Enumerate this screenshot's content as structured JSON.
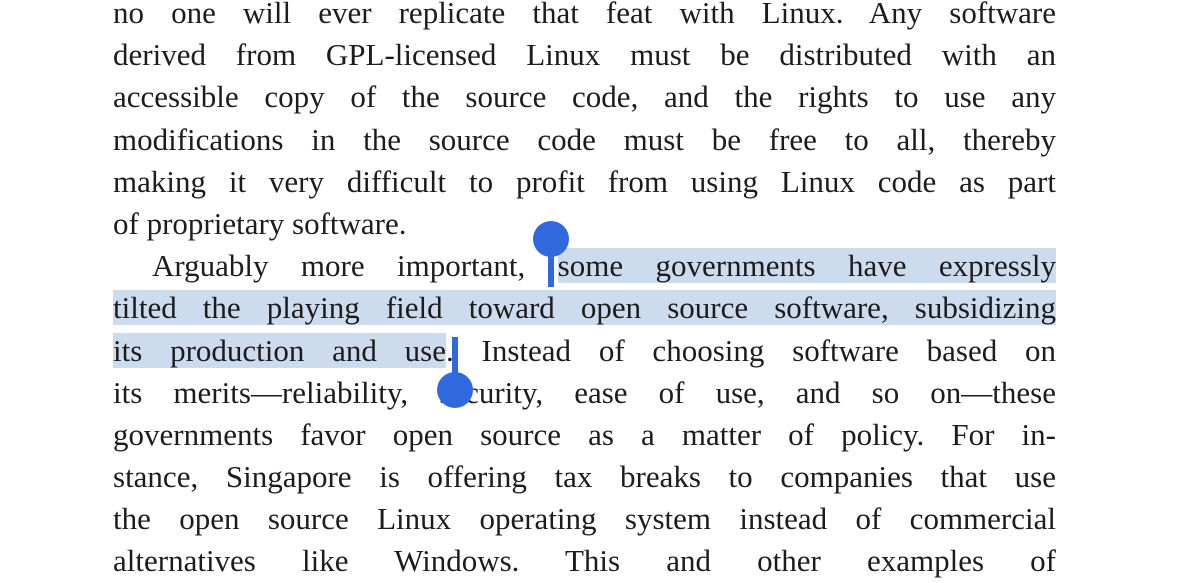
{
  "document": {
    "lines": [
      {
        "text": "no one will ever replicate that feat with Linux. Any software"
      },
      {
        "text": "derived from GPL-licensed Linux must be distributed with an"
      },
      {
        "text": "accessible copy of the source code, and the rights to use any"
      },
      {
        "text": "modifications in the source code must be free to all, thereby"
      },
      {
        "text": "making it very difficult to profit from using Linux code as part"
      },
      {
        "text": "of proprietary software."
      },
      {
        "before": "Arguably more important, ",
        "selected": "some governments have expressly"
      },
      {
        "selected": "tilted the playing field toward open source software, subsidizing"
      },
      {
        "selected": "its production and use",
        "after": ". Instead of choosing software based on"
      },
      {
        "text": "its merits—reliability, security, ease of use, and so on—these"
      },
      {
        "text": "governments favor open source as a matter of policy. For in-"
      },
      {
        "text": "stance, Singapore is offering tax breaks to companies that use"
      },
      {
        "text": "the open source Linux operating system instead of commercial"
      },
      {
        "text": "alternatives like Windows. This and other examples of"
      }
    ]
  },
  "selection": {
    "text": "some governments have expressly tilted the playing field toward open source software, subsidizing its production and use",
    "highlight_color": "#cddbee",
    "handle_color": "#3069de"
  }
}
